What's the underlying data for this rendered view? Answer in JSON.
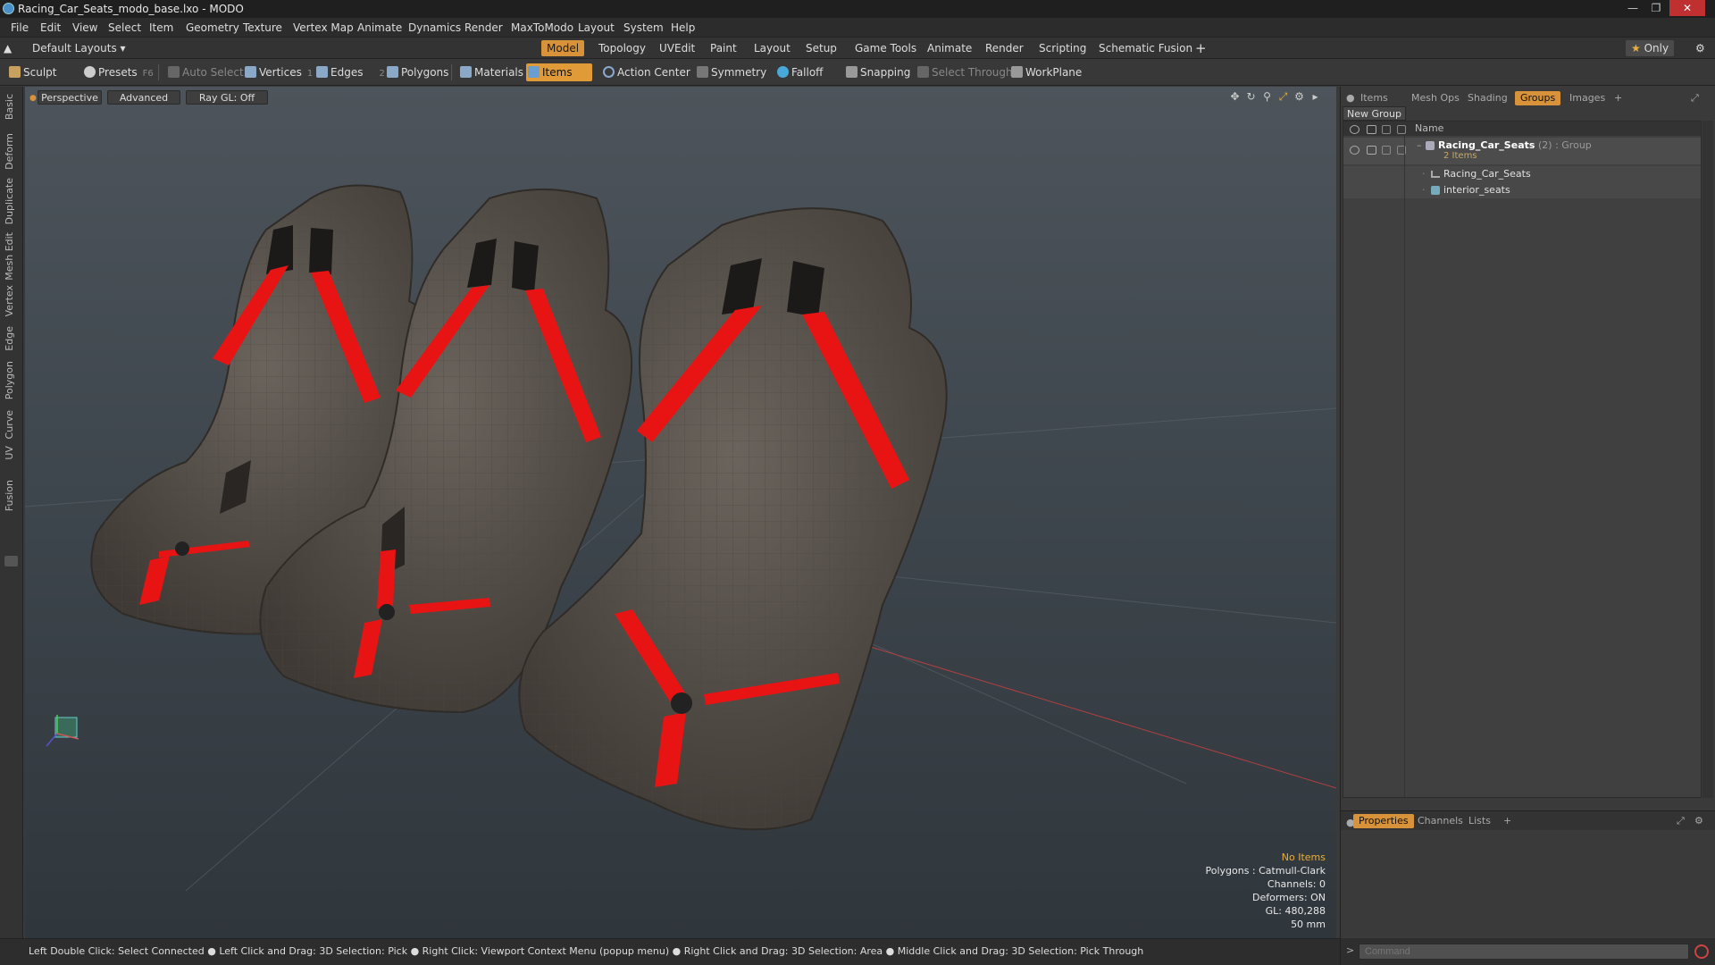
{
  "window": {
    "title": "Racing_Car_Seats_modo_base.lxo - MODO",
    "controls": [
      "minimize-icon",
      "restore-icon",
      "close-icon"
    ]
  },
  "menu": [
    "File",
    "Edit",
    "View",
    "Select",
    "Item",
    "Geometry",
    "Texture",
    "Vertex Map",
    "Animate",
    "Dynamics",
    "Render",
    "MaxToModo",
    "Layout",
    "System",
    "Help"
  ],
  "layout_bar": {
    "layout_selector": "Default Layouts",
    "tabs": [
      "Model",
      "Topology",
      "UVEdit",
      "Paint",
      "Layout",
      "Setup",
      "Game Tools",
      "Animate",
      "Render",
      "Scripting",
      "Schematic Fusion"
    ],
    "active_tab": "Model",
    "add_label": "+",
    "only_label": "Only"
  },
  "toolbar": {
    "sculpt": "Sculpt",
    "presets": "Presets",
    "presets_key": "F6",
    "auto_select": "Auto Select",
    "vertices": "Vertices",
    "vertices_count": "1",
    "edges": "Edges",
    "edges_count": "2",
    "polygons": "Polygons",
    "materials": "Materials",
    "items": "Items",
    "action_center": "Action Center",
    "symmetry": "Symmetry",
    "falloff": "Falloff",
    "snapping": "Snapping",
    "select_through": "Select Through",
    "workplane": "WorkPlane"
  },
  "left_tabs": [
    "Basic",
    "Deform",
    "Duplicate",
    "Mesh Edit",
    "Vertex",
    "Edge",
    "Polygon",
    "Curve",
    "UV",
    "Fusion"
  ],
  "viewport": {
    "view_mode": "Perspective",
    "shading": "Advanced",
    "raygl": "Ray GL: Off",
    "stats": {
      "no_items": "No Items",
      "polygons": "Polygons : Catmull-Clark",
      "channels": "Channels: 0",
      "deformers": "Deformers: ON",
      "gl": "GL: 480,288",
      "scale": "50 mm"
    }
  },
  "status_bar": "Left Double Click: Select Connected ● Left Click and Drag: 3D Selection: Pick ● Right Click: Viewport Context Menu (popup menu) ● Right Click and Drag: 3D Selection: Area ● Middle Click and Drag: 3D Selection: Pick Through",
  "right_panel": {
    "tabs": [
      "Items",
      "Mesh Ops",
      "Shading",
      "Groups",
      "Images",
      "+"
    ],
    "active_tab": "Groups",
    "new_group": "New Group",
    "column_name": "Name",
    "tree": [
      {
        "label": "Racing_Car_Seats",
        "suffix": "(2) : Group",
        "sub": "2 Items",
        "icon": "group-icon"
      },
      {
        "label": "Racing_Car_Seats",
        "icon": "mesh-icon"
      },
      {
        "label": "interior_seats",
        "icon": "shader-icon"
      }
    ],
    "bottom_tabs": [
      "Properties",
      "Channels",
      "Lists",
      "+"
    ],
    "bottom_active": "Properties",
    "command_placeholder": "Command"
  },
  "colors": {
    "accent": "#d8923a",
    "seat": "#5a534d",
    "belt": "#e81414",
    "viewport_bg": "#434b52"
  }
}
